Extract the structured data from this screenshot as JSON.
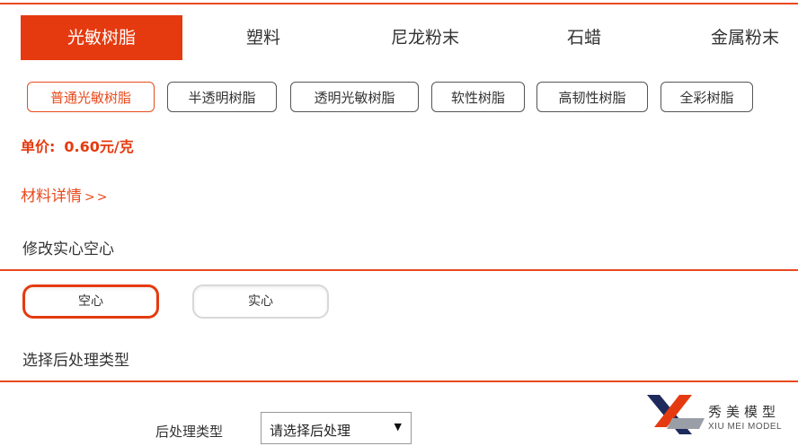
{
  "main_tabs": [
    {
      "label": "光敏树脂",
      "active": true
    },
    {
      "label": "塑料",
      "active": false
    },
    {
      "label": "尼龙粉末",
      "active": false
    },
    {
      "label": "石蜡",
      "active": false
    },
    {
      "label": "金属粉末",
      "active": false
    }
  ],
  "sub_tabs": [
    {
      "label": "普通光敏树脂",
      "active": true
    },
    {
      "label": "半透明树脂",
      "active": false
    },
    {
      "label": "透明光敏树脂",
      "active": false
    },
    {
      "label": "软性树脂",
      "active": false
    },
    {
      "label": "高韧性树脂",
      "active": false
    },
    {
      "label": "全彩树脂",
      "active": false
    }
  ],
  "price": {
    "label": "单价:",
    "value": "0.60元/克"
  },
  "detail_link": {
    "label": "材料详情",
    "arrows": ">>"
  },
  "fill_section": {
    "title": "修改实心空心",
    "options": [
      {
        "label": "空心",
        "active": true
      },
      {
        "label": "实心",
        "active": false
      }
    ]
  },
  "post_section": {
    "title": "选择后处理类型",
    "field_label": "后处理类型",
    "selected": "请选择后处理"
  },
  "logo": {
    "name_cn": "秀美模型",
    "name_en": "XIU MEI MODEL"
  },
  "colors": {
    "accent": "#e53a0f",
    "accent_line": "#e84a1d",
    "text": "#333333"
  }
}
